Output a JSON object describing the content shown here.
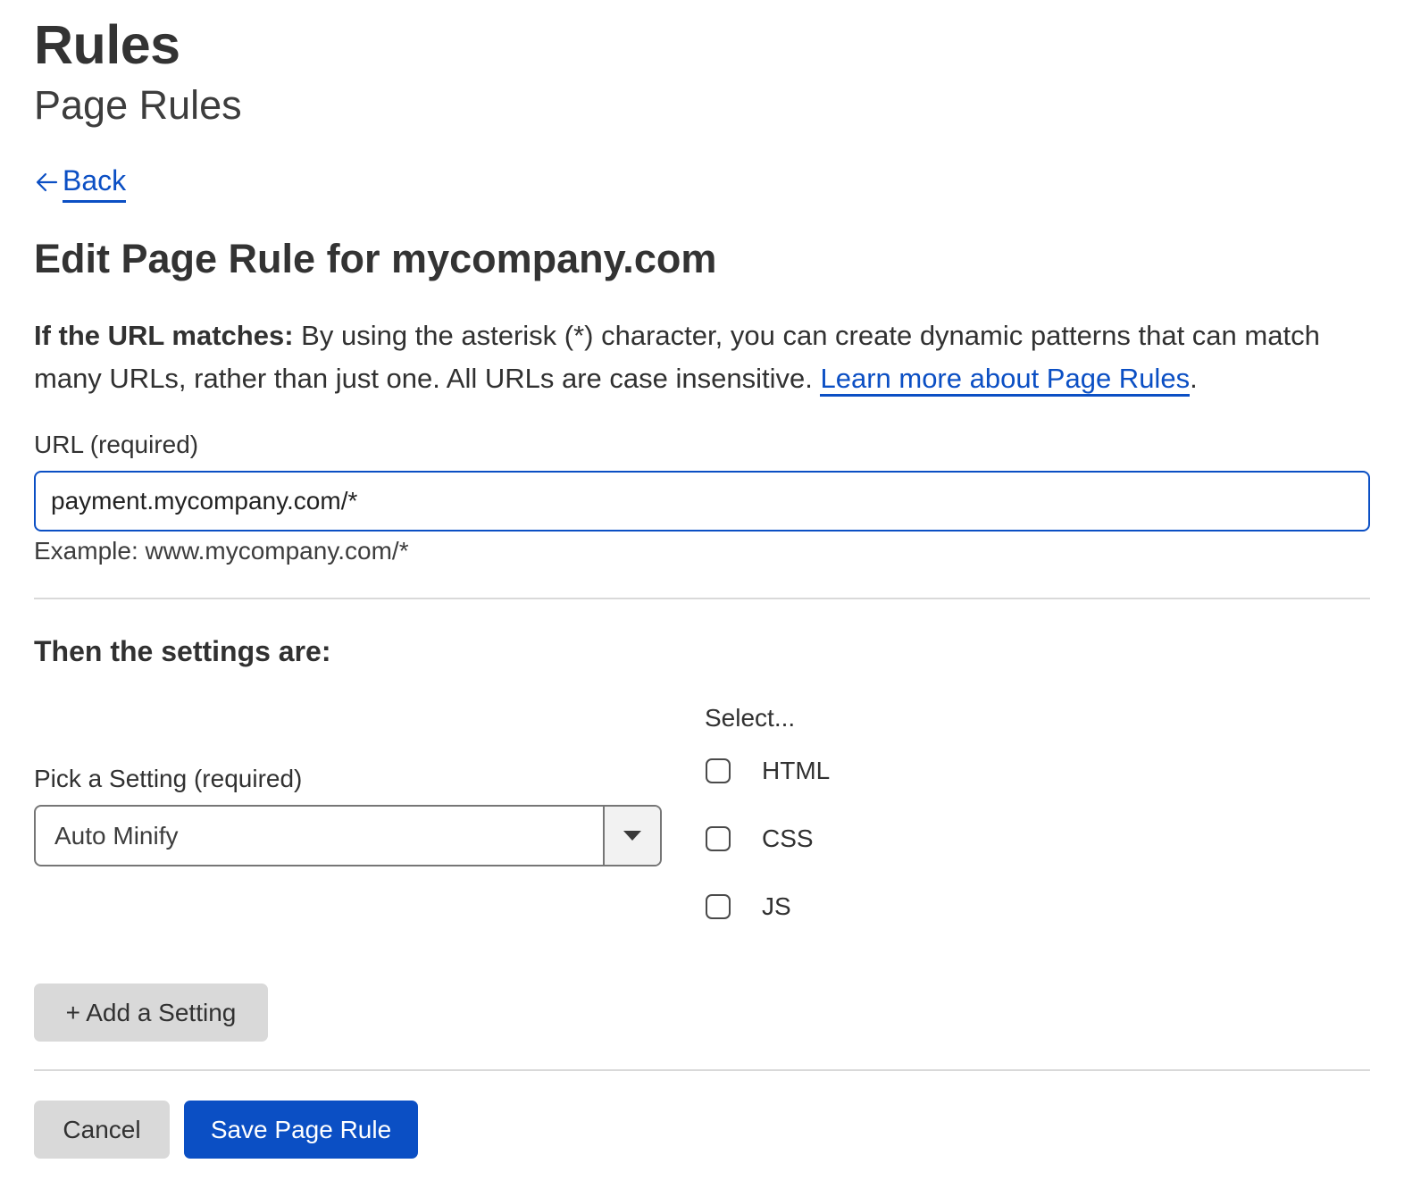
{
  "header": {
    "title": "Rules",
    "subtitle": "Page Rules"
  },
  "back": {
    "label": "Back",
    "icon": "arrow-left-icon"
  },
  "form": {
    "heading": "Edit Page Rule for mycompany.com",
    "description": {
      "lead": "If the URL matches:",
      "body": " By using the asterisk (*) character, you can create dynamic patterns that can match many URLs, rather than just one. All URLs are case insensitive. ",
      "link": "Learn more about Page Rules",
      "trailing": "."
    },
    "url": {
      "label": "URL (required)",
      "value": "payment.mycompany.com/*",
      "helper": "Example: www.mycompany.com/*"
    },
    "settings": {
      "heading": "Then the settings are:",
      "pick_label": "Pick a Setting (required)",
      "selected": "Auto Minify",
      "dropdown_icon": "caret-down-icon",
      "options_label": "Select...",
      "options": [
        {
          "label": "HTML",
          "checked": false
        },
        {
          "label": "CSS",
          "checked": false
        },
        {
          "label": "JS",
          "checked": false
        }
      ]
    },
    "add_setting_label": "+ Add a Setting"
  },
  "actions": {
    "cancel_label": "Cancel",
    "save_label": "Save Page Rule"
  },
  "colors": {
    "accent": "#0b4fc4",
    "text": "#313131",
    "button_secondary": "#d9d9d9",
    "divider": "#d9d9d9"
  }
}
